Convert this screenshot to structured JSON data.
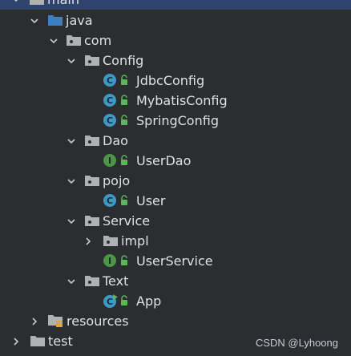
{
  "tree": {
    "main": "main",
    "java": "java",
    "com": "com",
    "config": "Config",
    "jdbc_config": "JdbcConfig",
    "mybatis_config": "MybatisConfig",
    "spring_config": "SpringConfig",
    "dao": "Dao",
    "user_dao": "UserDao",
    "pojo": "pojo",
    "user": "User",
    "service": "Service",
    "impl": "impl",
    "user_service": "UserService",
    "text": "Text",
    "app": "App",
    "resources": "resources",
    "test": "test"
  },
  "badges": {
    "class": "C",
    "interface": "I"
  },
  "watermark": "CSDN @Lyhoong",
  "colors": {
    "background": "#2b2d30",
    "selection": "#2e436e",
    "source_folder": "#3d7fc4",
    "package_folder": "#afb1b3",
    "class_badge": "#3d9ac4",
    "interface_badge": "#4a9645",
    "lock": "#5fb55a"
  }
}
